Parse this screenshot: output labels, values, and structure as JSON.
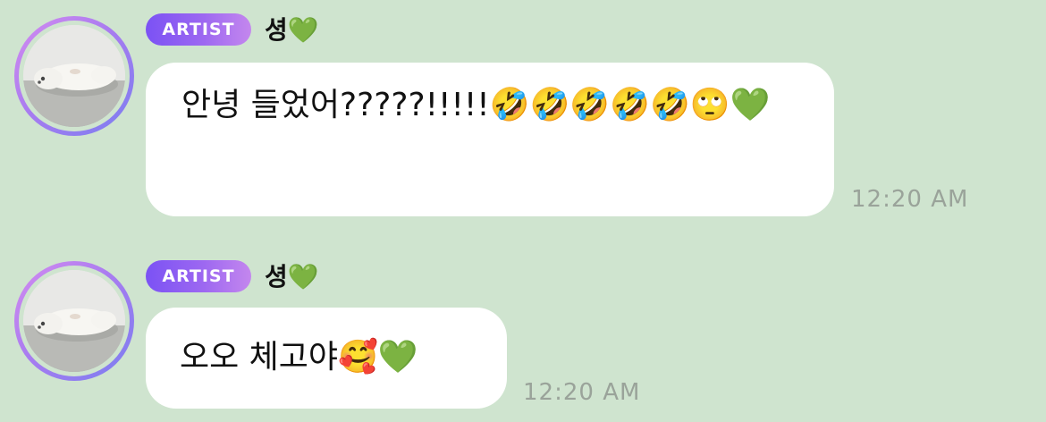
{
  "messages": [
    {
      "badge": "ARTIST",
      "sender": "셩💚",
      "text": "안녕 들었어?????!!!!!🤣🤣🤣🤣🤣🙄💚",
      "time": "12:20 AM"
    },
    {
      "badge": "ARTIST",
      "sender": "셩💚",
      "text": "오오 체고야🥰💚",
      "time": "12:20 AM"
    }
  ]
}
